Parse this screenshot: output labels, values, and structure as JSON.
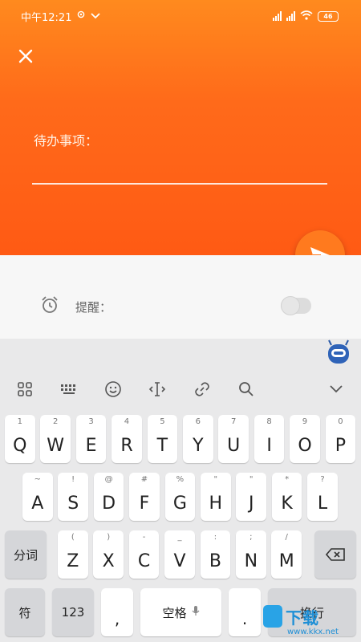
{
  "status_bar": {
    "time": "中午12:21",
    "battery": "46"
  },
  "form": {
    "todo_label": "待办事项：",
    "todo_value": "",
    "reminder_label": "提醒：",
    "reminder_enabled": false
  },
  "colors": {
    "header_orange": "#ff6a1a",
    "fab_orange": "#ff7a1e",
    "watermark_blue": "#1e8fd6"
  },
  "keyboard": {
    "toolbar_icons": [
      "grid-icon",
      "keyboard-layout-icon",
      "emoji-icon",
      "cursor-icon",
      "clipboard-icon",
      "search-icon",
      "chevron-down-icon"
    ],
    "row1": [
      {
        "hint": "1",
        "key": "Q"
      },
      {
        "hint": "2",
        "key": "W"
      },
      {
        "hint": "3",
        "key": "E"
      },
      {
        "hint": "4",
        "key": "R"
      },
      {
        "hint": "5",
        "key": "T"
      },
      {
        "hint": "6",
        "key": "Y"
      },
      {
        "hint": "7",
        "key": "U"
      },
      {
        "hint": "8",
        "key": "I"
      },
      {
        "hint": "9",
        "key": "O"
      },
      {
        "hint": "0",
        "key": "P"
      }
    ],
    "row2": [
      {
        "hint": "~",
        "key": "A"
      },
      {
        "hint": "!",
        "key": "S"
      },
      {
        "hint": "@",
        "key": "D"
      },
      {
        "hint": "#",
        "key": "F"
      },
      {
        "hint": "%",
        "key": "G"
      },
      {
        "hint": "\"",
        "key": "H"
      },
      {
        "hint": "\"",
        "key": "J"
      },
      {
        "hint": "*",
        "key": "K"
      },
      {
        "hint": "?",
        "key": "L"
      }
    ],
    "row3": [
      {
        "hint": "(",
        "key": "Z"
      },
      {
        "hint": ")",
        "key": "X"
      },
      {
        "hint": "-",
        "key": "C"
      },
      {
        "hint": "_",
        "key": "V"
      },
      {
        "hint": ":",
        "key": "B"
      },
      {
        "hint": ";",
        "key": "N"
      },
      {
        "hint": "/",
        "key": "M"
      }
    ],
    "shift_label": "分词",
    "symbol_label": "符",
    "numbers_label": "123",
    "comma": ",",
    "space_label": "空格",
    "period": ".",
    "enter_label": "换行"
  },
  "watermark": {
    "text": "下载",
    "url": "www.kkx.net"
  }
}
